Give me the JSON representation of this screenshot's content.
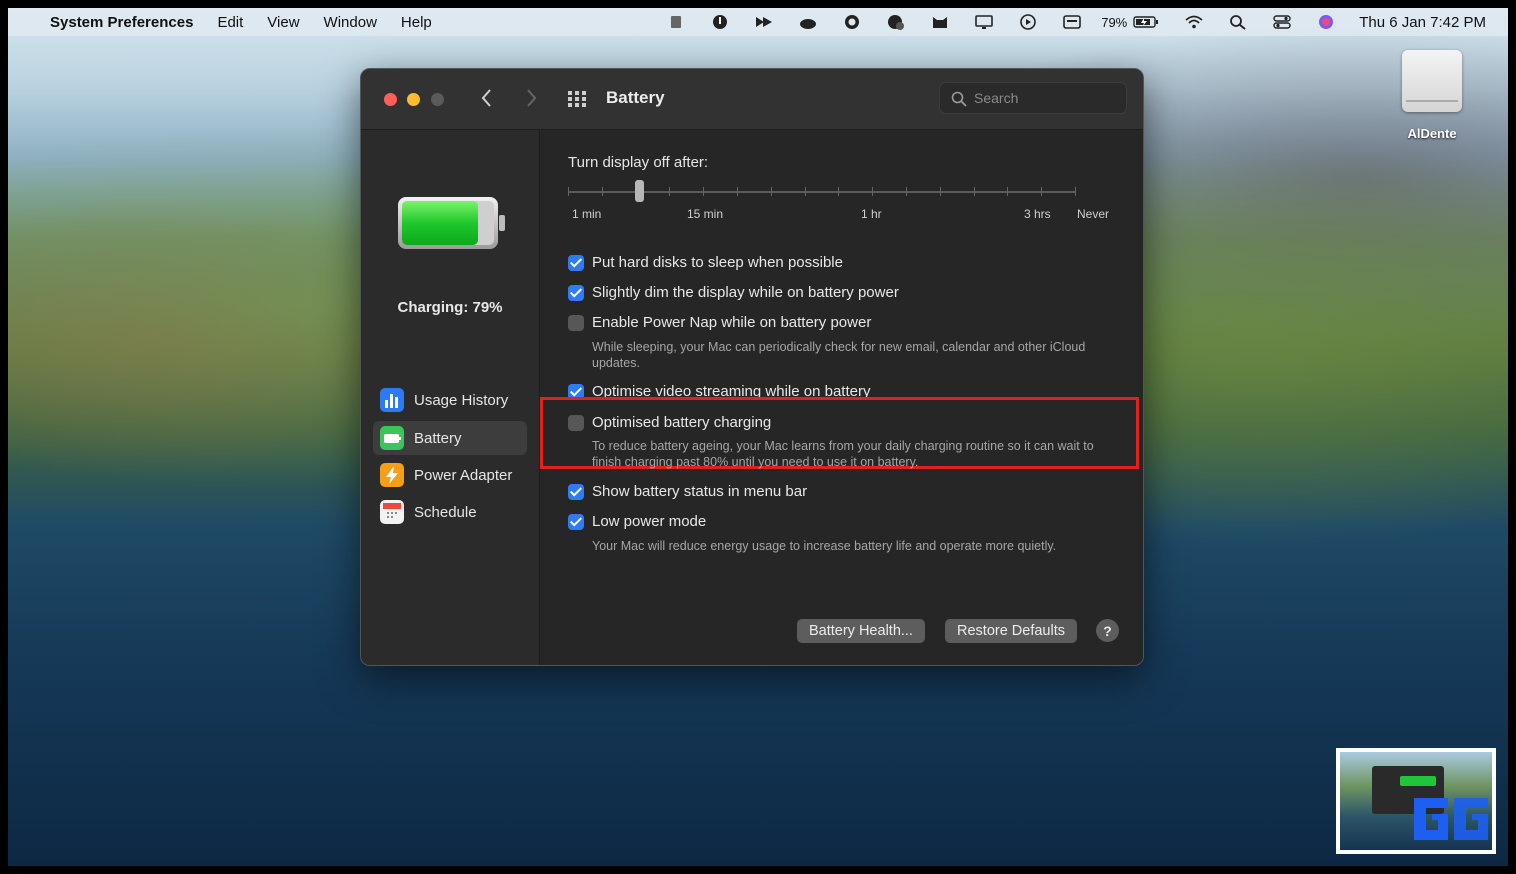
{
  "menubar": {
    "apple_glyph": "",
    "app_name": "System Preferences",
    "menus": [
      "Edit",
      "View",
      "Window",
      "Help"
    ],
    "battery_percent": "79%",
    "clock": "Thu 6 Jan  7:42 PM"
  },
  "desktop": {
    "drive_label": "AlDente"
  },
  "window": {
    "title": "Battery",
    "search_placeholder": "Search"
  },
  "sidebar": {
    "charging_status": "Charging: 79%",
    "items": [
      {
        "label": "Usage History",
        "icon": "bar-chart-icon",
        "color": "#2d7bf4"
      },
      {
        "label": "Battery",
        "icon": "battery-icon",
        "color": "#3cc65a"
      },
      {
        "label": "Power Adapter",
        "icon": "lightning-icon",
        "color": "#f59e18"
      },
      {
        "label": "Schedule",
        "icon": "calendar-icon",
        "color": "#f2f2f2"
      }
    ]
  },
  "settings": {
    "display_off_label": "Turn display off after:",
    "slider_ticks": [
      "1 min",
      "15 min",
      "1 hr",
      "3 hrs",
      "Never"
    ],
    "slider_value_fraction": 0.14,
    "options": [
      {
        "label": "Put hard disks to sleep when possible",
        "checked": true
      },
      {
        "label": "Slightly dim the display while on battery power",
        "checked": true
      },
      {
        "label": "Enable Power Nap while on battery power",
        "checked": false,
        "description": "While sleeping, your Mac can periodically check for new email, calendar and other iCloud updates."
      },
      {
        "label": "Optimise video streaming while on battery",
        "checked": true
      },
      {
        "label": "Optimised battery charging",
        "checked": false,
        "description": "To reduce battery ageing, your Mac learns from your daily charging routine so it can wait to finish charging past 80% until you need to use it on battery."
      },
      {
        "label": "Show battery status in menu bar",
        "checked": true
      },
      {
        "label": "Low power mode",
        "checked": true,
        "description": "Your Mac will reduce energy usage to increase battery life and operate more quietly."
      }
    ],
    "battery_health_button": "Battery Health...",
    "restore_defaults_button": "Restore Defaults",
    "help_button": "?"
  },
  "colors": {
    "accent": "#2f7bf5",
    "highlight": "#e0231a",
    "battery_fill": "#2ecf3e"
  }
}
